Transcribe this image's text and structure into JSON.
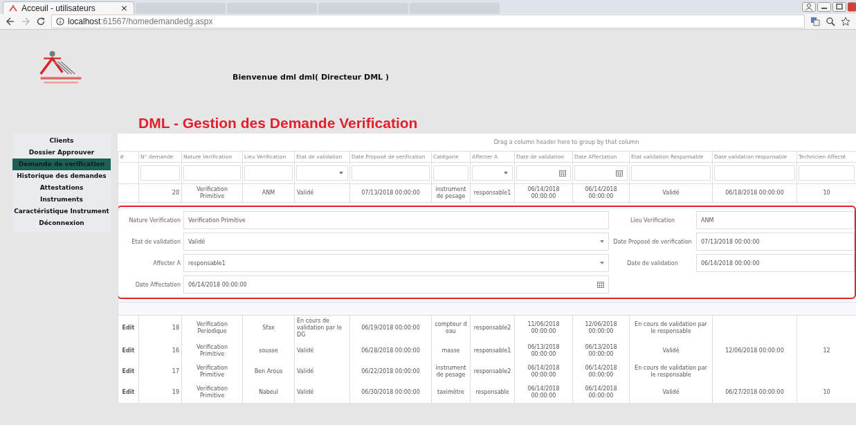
{
  "browser": {
    "tabs": [
      {
        "title": "Acceuil - utilisateurs",
        "close": "×",
        "selected": true
      },
      {
        "selected": false
      },
      {
        "selected": false
      },
      {
        "selected": false
      },
      {
        "selected": false
      }
    ],
    "url_host": "localhost",
    "url_path": ":61567/homedemandedg.aspx"
  },
  "header": {
    "welcome": "Bienvenue dml dml( Directeur DML )",
    "title": "DML - Gestion des Demande Verification"
  },
  "sidebar": {
    "items": [
      {
        "label": "Clients",
        "selected": false
      },
      {
        "label": "Dossier Approuver",
        "selected": false
      },
      {
        "label": "Demande de verification",
        "selected": true
      },
      {
        "label": "Historique des demandes",
        "selected": false
      },
      {
        "label": "Attestations",
        "selected": false
      },
      {
        "label": "Instruments",
        "selected": false
      },
      {
        "label": "Caractéristique Instrument",
        "selected": false
      },
      {
        "label": "Déconnexion",
        "selected": false
      }
    ]
  },
  "grid": {
    "group_hint": "Drag a column header here to group by that column",
    "columns": [
      "#",
      "N° demande",
      "Nature Verification",
      "Lieu Verification",
      "Etat de validation",
      "Date Proposé de verification",
      "Catégorie",
      "Affecter A",
      "Date de validation",
      "Date Affectation",
      "Etat validation Responsable",
      "Date validation responsable",
      "Technicien Affecté"
    ],
    "filters": [
      {
        "kind": "none"
      },
      {
        "kind": "text"
      },
      {
        "kind": "text"
      },
      {
        "kind": "text"
      },
      {
        "kind": "dropdown"
      },
      {
        "kind": "text"
      },
      {
        "kind": "text"
      },
      {
        "kind": "dropdown"
      },
      {
        "kind": "date"
      },
      {
        "kind": "date"
      },
      {
        "kind": "text"
      },
      {
        "kind": "text"
      },
      {
        "kind": "text"
      }
    ],
    "expanded_row": {
      "cells": [
        "",
        "20",
        "Verification Primitive",
        "ANM",
        "Validé",
        "07/13/2018 00:00:00",
        "instrument de pesage",
        "responsable1",
        "06/14/2018 00:00:00",
        "06/14/2018 00:00:00",
        "Validé",
        "06/18/2018 00:00:00",
        "10"
      ]
    },
    "edit_form": {
      "left_fields": [
        {
          "label": "Nature Verification",
          "value": "Verification Primitive",
          "kind": "text"
        },
        {
          "label": "Etat de validation",
          "value": "Validé",
          "kind": "dropdown"
        },
        {
          "label": "Affecter A",
          "value": "responsable1",
          "kind": "dropdown"
        },
        {
          "label": "Date Affectation",
          "value": "06/14/2018 00:00:00",
          "kind": "date"
        }
      ],
      "right_fields": [
        {
          "label": "Lieu Verification",
          "value": "ANM"
        },
        {
          "label": "Date Proposé de verification",
          "value": "07/13/2018 00:00:00"
        },
        {
          "label": "Date de validation",
          "value": "06/14/2018 00:00:00"
        }
      ]
    },
    "rows": [
      {
        "cells": [
          "Edit",
          "18",
          "Verification Periodique",
          "Sfax",
          "En cours de validation par le DG",
          "06/19/2018 00:00:00",
          "compteur d eau",
          "responsable2",
          "11/06/2018 00:00:00",
          "12/06/2018 00:00:00",
          "En cours de validation par le responsable",
          null,
          null
        ]
      },
      {
        "cells": [
          "Edit",
          "16",
          "Verification Primitive",
          "sousse",
          "Validé",
          "06/28/2018 00:00:00",
          "masse",
          "responsable1",
          "06/13/2018 00:00:00",
          "06/13/2018 00:00:00",
          "Validé",
          "12/06/2018 00:00:00",
          "12"
        ]
      },
      {
        "cells": [
          "Edit",
          "17",
          "Verification Primitive",
          "Ben Arous",
          "Validé",
          "06/22/2018 00:00:00",
          "instrument de pesage",
          "responsable2",
          "06/14/2018 00:00:00",
          "06/14/2018 00:00:00",
          "En cours de validation par le responsable",
          null,
          null
        ]
      },
      {
        "cells": [
          "Edit",
          "19",
          "Verification Primitive",
          "Nabeul",
          "Validé",
          "06/30/2018 00:00:00",
          "taximètre",
          "responsable",
          "06/14/2018 00:00:00",
          "06/14/2018 00:00:00",
          "Validé",
          "06/27/2018 00:00:00",
          "10"
        ]
      }
    ]
  }
}
